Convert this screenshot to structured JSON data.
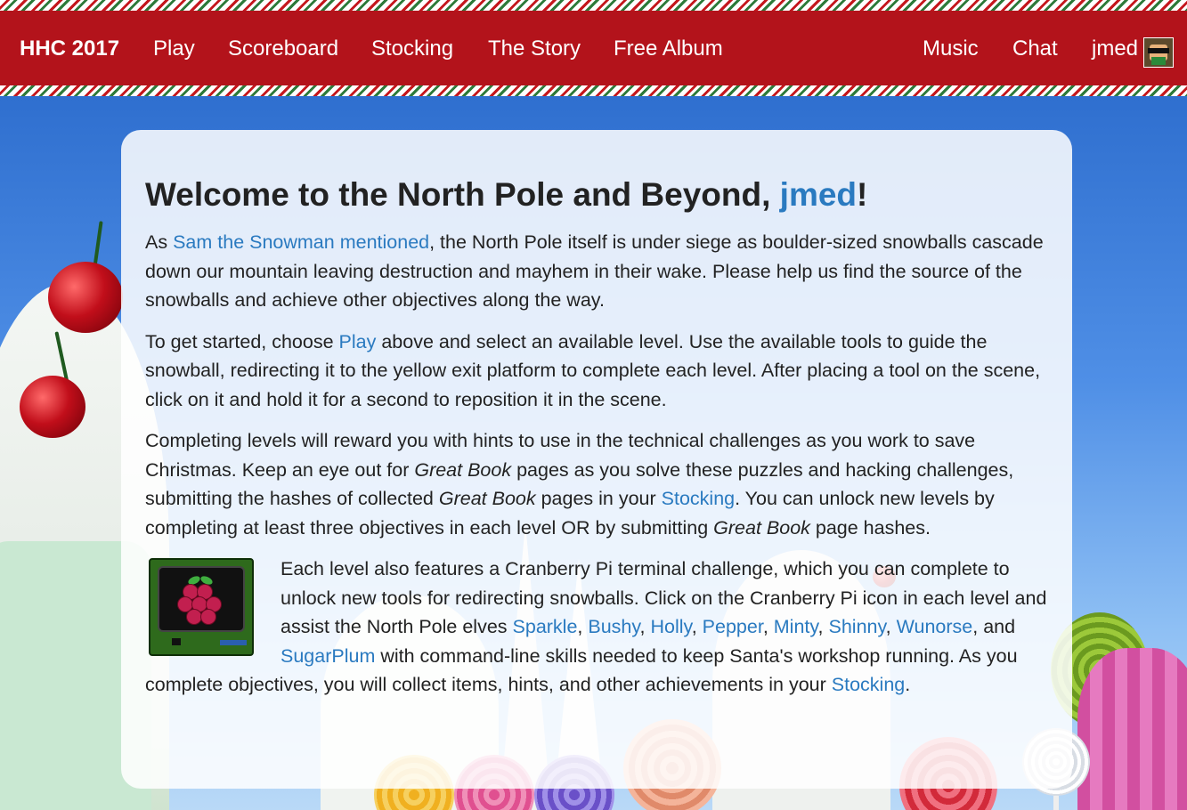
{
  "nav": {
    "brand": "HHC 2017",
    "left_items": [
      "Play",
      "Scoreboard",
      "Stocking",
      "The Story",
      "Free Album"
    ],
    "right_items": [
      "Music",
      "Chat"
    ],
    "user": "jmed"
  },
  "welcome": {
    "title_prefix": "Welcome to the North Pole and Beyond, ",
    "title_user": "jmed",
    "title_suffix": "!"
  },
  "p1": {
    "a": "As ",
    "link": "Sam the Snowman mentioned",
    "b": ", the North Pole itself is under siege as boulder-sized snowballs cascade down our mountain leaving destruction and mayhem in their wake. Please help us find the source of the snowballs and achieve other objectives along the way."
  },
  "p2": {
    "a": "To get started, choose ",
    "link": "Play",
    "b": " above and select an available level. Use the available tools to guide the snowball, redirecting it to the yellow exit platform to complete each level. After placing a tool on the scene, click on it and hold it for a second to reposition it in the scene."
  },
  "p3": {
    "a": "Completing levels will reward you with hints to use in the technical challenges as you work to save Christmas. Keep an eye out for ",
    "em1": "Great Book",
    "b": " pages as you solve these puzzles and hacking challenges, submitting the hashes of collected ",
    "em2": "Great Book",
    "c": " pages in your ",
    "link": "Stocking",
    "d": ". You can unlock new levels by completing at least three objectives in each level OR by submitting ",
    "em3": "Great Book",
    "e": " page hashes."
  },
  "p4": {
    "a": "Each level also features a Cranberry Pi terminal challenge, which you can complete to unlock new tools for redirecting snowballs. Click on the Cranberry Pi icon in each level and assist the North Pole elves ",
    "elves": [
      "Sparkle",
      "Bushy",
      "Holly",
      "Pepper",
      "Minty",
      "Shinny",
      "Wunorse",
      "SugarPlum"
    ],
    "sep": ", ",
    "and": ", and ",
    "b": " with command-line skills needed to keep Santa's workshop running. As you complete objectives, you will collect items, hints, and other achievements in your ",
    "link": "Stocking",
    "c": "."
  },
  "icons": {
    "avatar": "user-avatar-icon",
    "terminal": "cranberry-pi-terminal-icon"
  },
  "colors": {
    "navbar": "#b3131b",
    "link": "#2a7ac0",
    "sky": "#3f7fd6"
  }
}
